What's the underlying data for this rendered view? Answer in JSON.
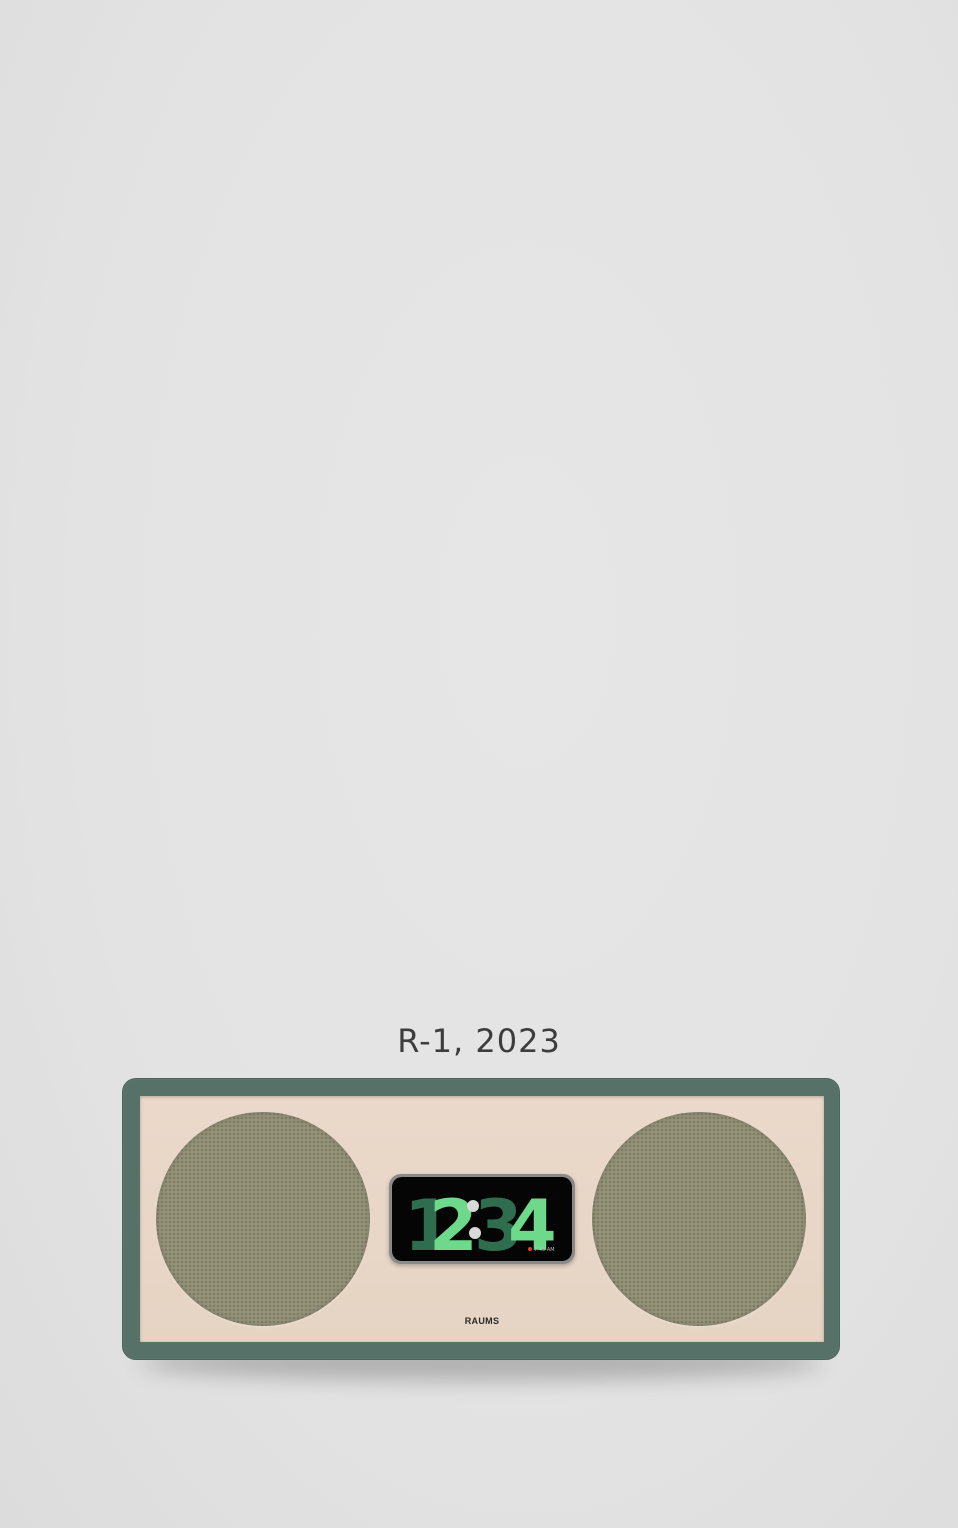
{
  "caption": "R-1, 2023",
  "device": {
    "brand": "RAUMS",
    "clock": {
      "digits": [
        "1",
        "2",
        "3",
        "4"
      ],
      "alarm_text": "7:45 AM"
    }
  },
  "colors": {
    "background": "#e3e3e3",
    "frame": "#567167",
    "face": "#e8d7c7",
    "speaker_grille": "#939178",
    "digit_dark": "#2e6e4e",
    "digit_light": "#6ed98a",
    "alarm_dot": "#e53935"
  },
  "icons": {
    "alarm": "alarm-dot-icon"
  }
}
